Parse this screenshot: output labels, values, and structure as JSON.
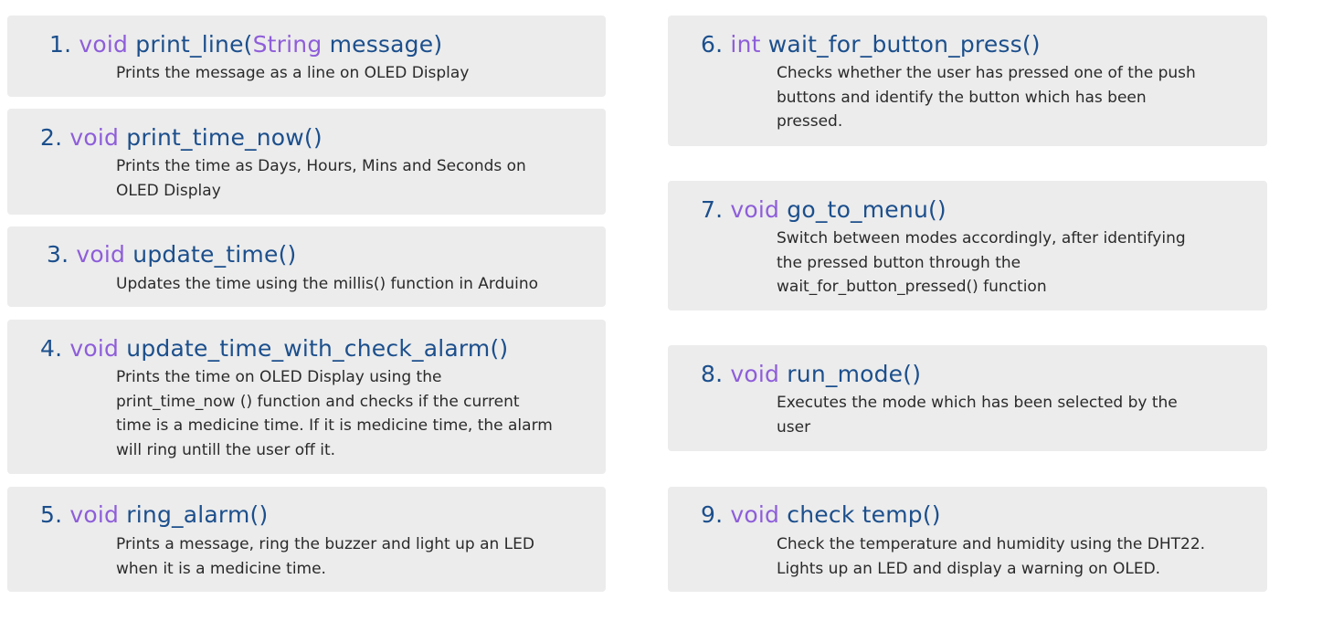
{
  "functions": [
    {
      "number": "1.",
      "keyword": "void",
      "name": "print_line(",
      "param_type": "String",
      "param_name": "message)",
      "desc_lines": [
        "Prints the message as a line on OLED Display"
      ]
    },
    {
      "number": "2.",
      "keyword": "void",
      "name": "print_time_now()",
      "desc_lines": [
        "Prints the time as Days, Hours, Mins and Seconds on",
        "OLED Display"
      ]
    },
    {
      "number": "3.",
      "keyword": "void",
      "name": "update_time()",
      "desc_lines": [
        "Updates the time using the millis() function in Arduino"
      ]
    },
    {
      "number": "4.",
      "keyword": "void",
      "name": "update_time_with_check_alarm()",
      "desc_lines": [
        "Prints the time on OLED Display using the",
        "print_time_now () function and checks if the current",
        "time is a medicine time. If it is medicine time, the alarm",
        "will ring untill the user off it."
      ]
    },
    {
      "number": "5.",
      "keyword": "void",
      "name": "ring_alarm()",
      "desc_lines": [
        "Prints a message, ring the buzzer and light up an LED",
        "when it is a medicine time."
      ]
    },
    {
      "number": "6.",
      "keyword": "int",
      "name": "wait_for_button_press()",
      "desc_lines": [
        "Checks whether the user has pressed one of the push",
        "buttons and identify the button which has been",
        "pressed."
      ]
    },
    {
      "number": "7.",
      "keyword": "void",
      "name": "go_to_menu()",
      "desc_lines": [
        "Switch between modes accordingly, after identifying",
        "the pressed button through the",
        "wait_for_button_pressed() function"
      ]
    },
    {
      "number": "8.",
      "keyword": "void",
      "name": "run_mode()",
      "desc_lines": [
        "Executes the mode which has been selected by the",
        "user"
      ]
    },
    {
      "number": "9.",
      "keyword": "void",
      "name": "check temp()",
      "desc_lines": [
        "Check the temperature and humidity using the DHT22.",
        "Lights up an LED and display a warning on OLED."
      ]
    }
  ]
}
